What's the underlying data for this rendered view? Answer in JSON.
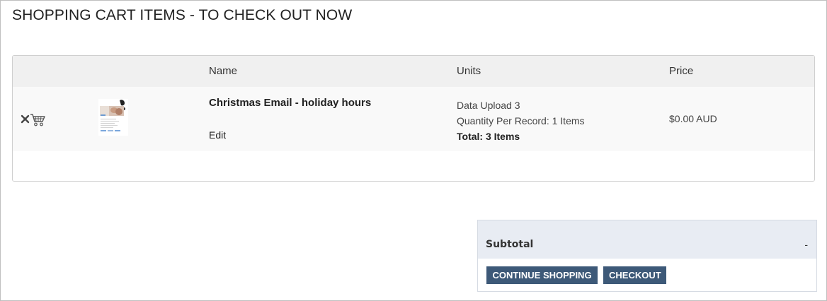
{
  "page": {
    "title": "SHOPPING CART ITEMS - TO CHECK OUT NOW"
  },
  "cart": {
    "columns": {
      "name": "Name",
      "units": "Units",
      "price": "Price"
    },
    "items": [
      {
        "remove_icon": "remove-from-cart-icon",
        "thumbnail": "email-template-thumbnail",
        "name": "Christmas Email - holiday hours",
        "edit_label": "Edit",
        "units": {
          "line1": "Data Upload 3",
          "line2": "Quantity Per Record: 1 Items",
          "total": "Total: 3 Items"
        },
        "price": "$0.00 AUD"
      }
    ]
  },
  "summary": {
    "subtotal_label": "Subtotal",
    "subtotal_value": "-",
    "continue_label": "CONTINUE SHOPPING",
    "checkout_label": "CHECKOUT"
  },
  "colors": {
    "button_bg": "#3d5978",
    "summary_header_bg": "#e8ecf3",
    "table_header_bg": "#f0f0f0"
  }
}
